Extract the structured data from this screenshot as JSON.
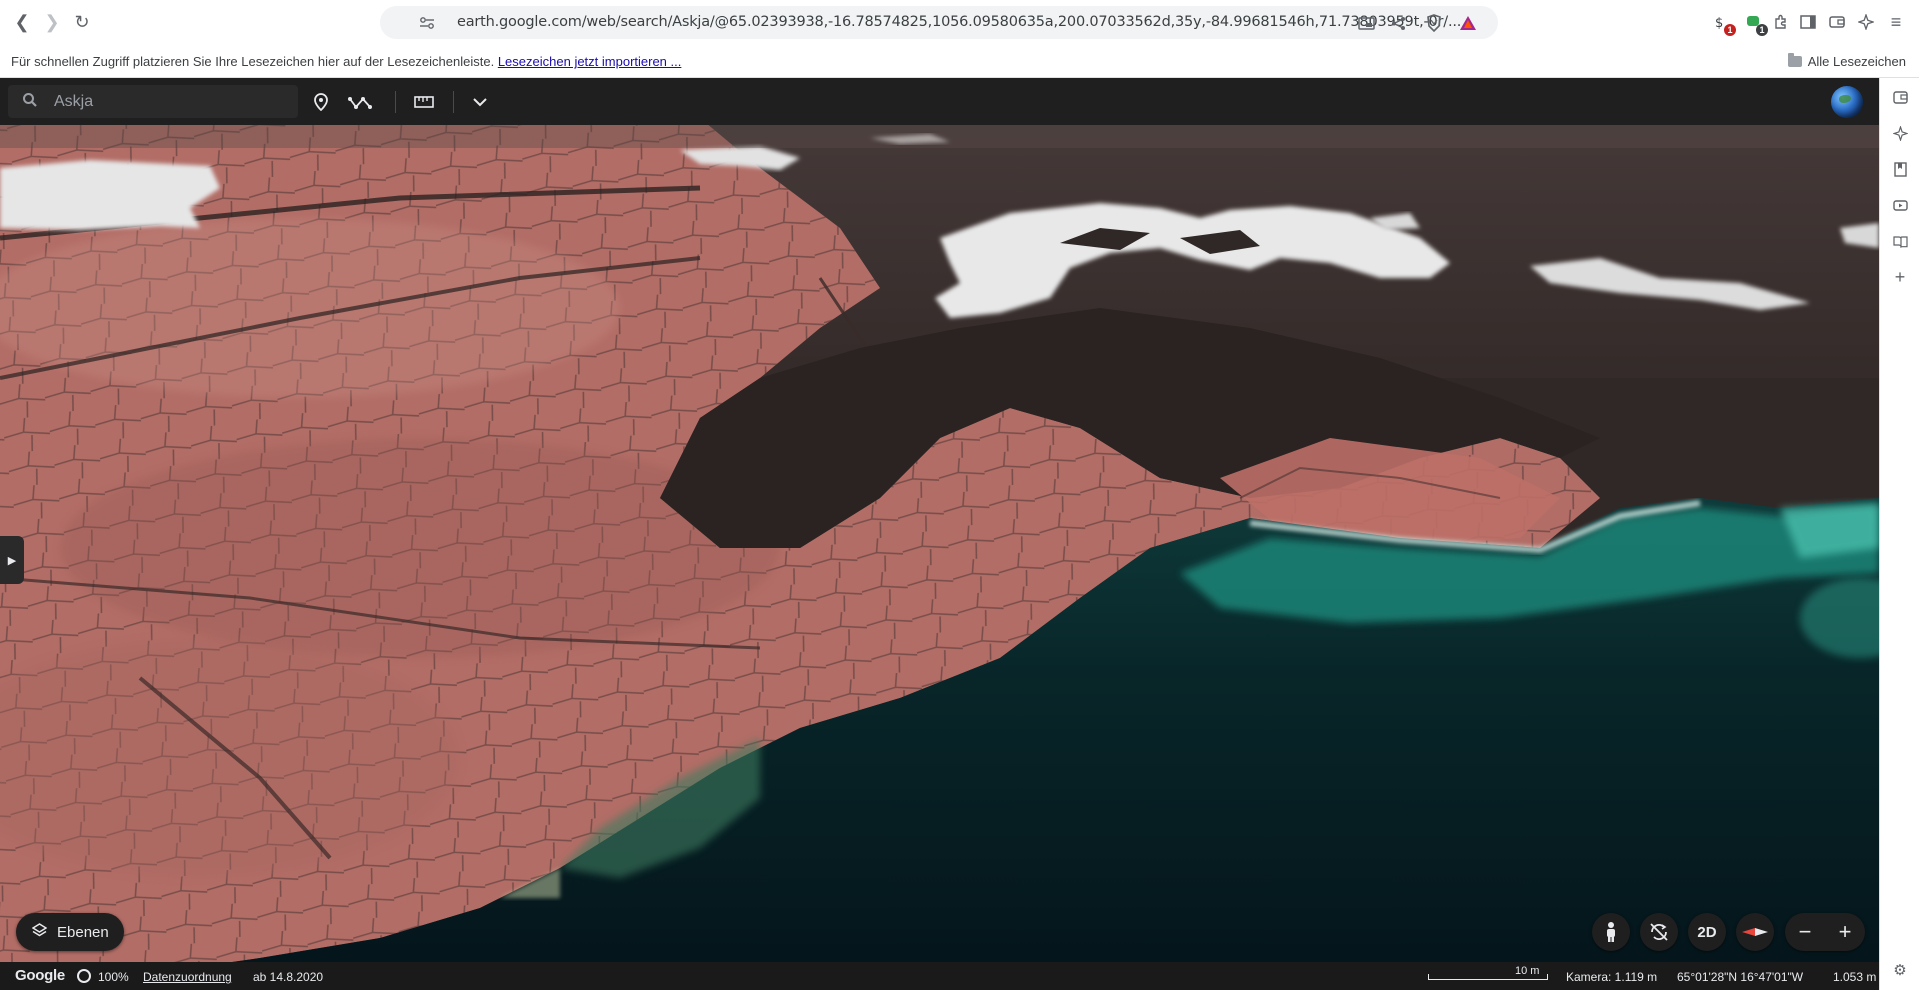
{
  "browser": {
    "url": "earth.google.com/web/search/Askja/@65.02393938,-16.78574825,1056.09580635a,200.07033562d,35y,-84.99681546h,71.73803959t,-0r/...",
    "extension_badges": [
      "1",
      "1"
    ]
  },
  "bookmarks_bar": {
    "hint_text": "Für schnellen Zugriff platzieren Sie Ihre Lesezeichen hier auf der Lesezeichenleiste.",
    "import_link": "Lesezeichen jetzt importieren ...",
    "all_bookmarks": "Alle Lesezeichen"
  },
  "earth": {
    "search": {
      "value": "",
      "placeholder": "Askja"
    },
    "layers_label": "Ebenen",
    "mode_2d": "2D",
    "status": {
      "logo": "Google",
      "percent": "100%",
      "attribution": "Datenzuordnung",
      "imagery_date": "ab 14.8.2020",
      "scale_label": "10 m",
      "camera": "Kamera: 1.119 m",
      "coordinates": "65°01'28\"N 16°47'01\"W",
      "elevation": "1.053 m"
    }
  },
  "icons": {
    "back": "back-arrow-icon",
    "forward": "forward-arrow-icon",
    "reload": "reload-icon",
    "bookmark": "bookmark-icon",
    "site_settings": "site-settings-icon",
    "cast": "cast-icon",
    "share": "share-icon",
    "brave": "brave-shield-icon",
    "rewards": "brave-rewards-icon",
    "search": "search-icon",
    "placemark": "placemark-icon",
    "path": "path-icon",
    "ruler": "ruler-icon",
    "chevron": "chevron-down-icon",
    "layers": "layers-icon",
    "pegman": "pegman-icon",
    "compass": "compass-icon"
  },
  "colors": {
    "earth_bar": "#1f1f1f",
    "lava_red": "#b87068",
    "lava_dark": "#2e2624",
    "lake_teal": "#1c7a70",
    "lake_dark": "#05181b",
    "snow": "#e6e6e6"
  }
}
